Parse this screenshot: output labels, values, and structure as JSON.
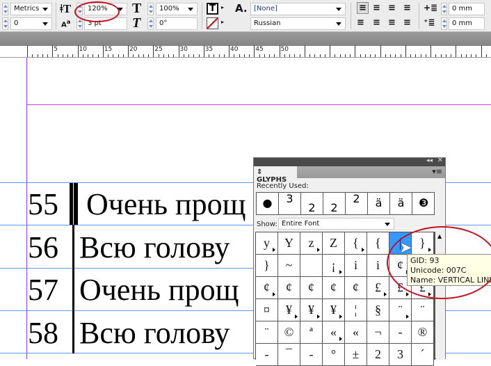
{
  "toolbar": {
    "kerning": "Metrics",
    "tracking": "0",
    "leading": "120%",
    "baseline_shift": "3 pt",
    "horizontal_scale": "100%",
    "skew": "0°",
    "char_style": "[None]",
    "language": "Russian",
    "left_indent": "0 mm",
    "first_line_indent": "0 mm"
  },
  "ruler": {
    "labels": [
      "5",
      "10",
      "15",
      "20",
      "25",
      "30",
      "35",
      "40",
      "45",
      "50"
    ]
  },
  "document": {
    "lines": [
      {
        "num": "55",
        "text": "Очень прощ"
      },
      {
        "num": "56",
        "text": "Всю голову"
      },
      {
        "num": "57",
        "text": "Очень прощ"
      },
      {
        "num": "58",
        "text": "Всю голову"
      }
    ]
  },
  "glyphs_panel": {
    "title": "GLYPHS",
    "recently_used_label": "Recently Used:",
    "recent": [
      "●",
      "3",
      "2",
      "2",
      "2",
      "ä",
      "ä",
      "❸"
    ],
    "show_label": "Show:",
    "show_value": "Entire Font",
    "grid": [
      [
        "y",
        "Y",
        "z",
        "Z",
        "{",
        "{",
        "|",
        "}"
      ],
      [
        "}",
        "~",
        "",
        "¡",
        "i",
        "i",
        "¢",
        ""
      ],
      [
        "¢",
        "¢",
        "¢",
        "¢",
        "¢",
        "£",
        "£",
        "£"
      ],
      [
        "¤",
        "¥",
        "¥",
        "¥",
        "¦",
        "§",
        "¨",
        "¨"
      ],
      [
        "¨",
        "©",
        "ª",
        "«",
        "«",
        "¬",
        "-",
        "®"
      ],
      [
        "-",
        "¯",
        "-",
        "°",
        "±",
        "2",
        "3",
        "´"
      ]
    ],
    "subs": [
      [
        1,
        0,
        1,
        0,
        1,
        0,
        0,
        1
      ],
      [
        0,
        0,
        0,
        1,
        0,
        0,
        1,
        0
      ],
      [
        1,
        0,
        0,
        0,
        0,
        1,
        1,
        1
      ],
      [
        0,
        1,
        1,
        1,
        0,
        0,
        1,
        0
      ],
      [
        0,
        0,
        0,
        1,
        0,
        0,
        0,
        0
      ],
      [
        0,
        0,
        0,
        0,
        0,
        0,
        0,
        0
      ]
    ],
    "selected_color": "#3399ff",
    "tooltip": {
      "gid": "GID: 93",
      "unicode": "Unicode: 007C",
      "name": "Name: VERTICAL LINE"
    }
  },
  "annotation_color": "#c8101e"
}
